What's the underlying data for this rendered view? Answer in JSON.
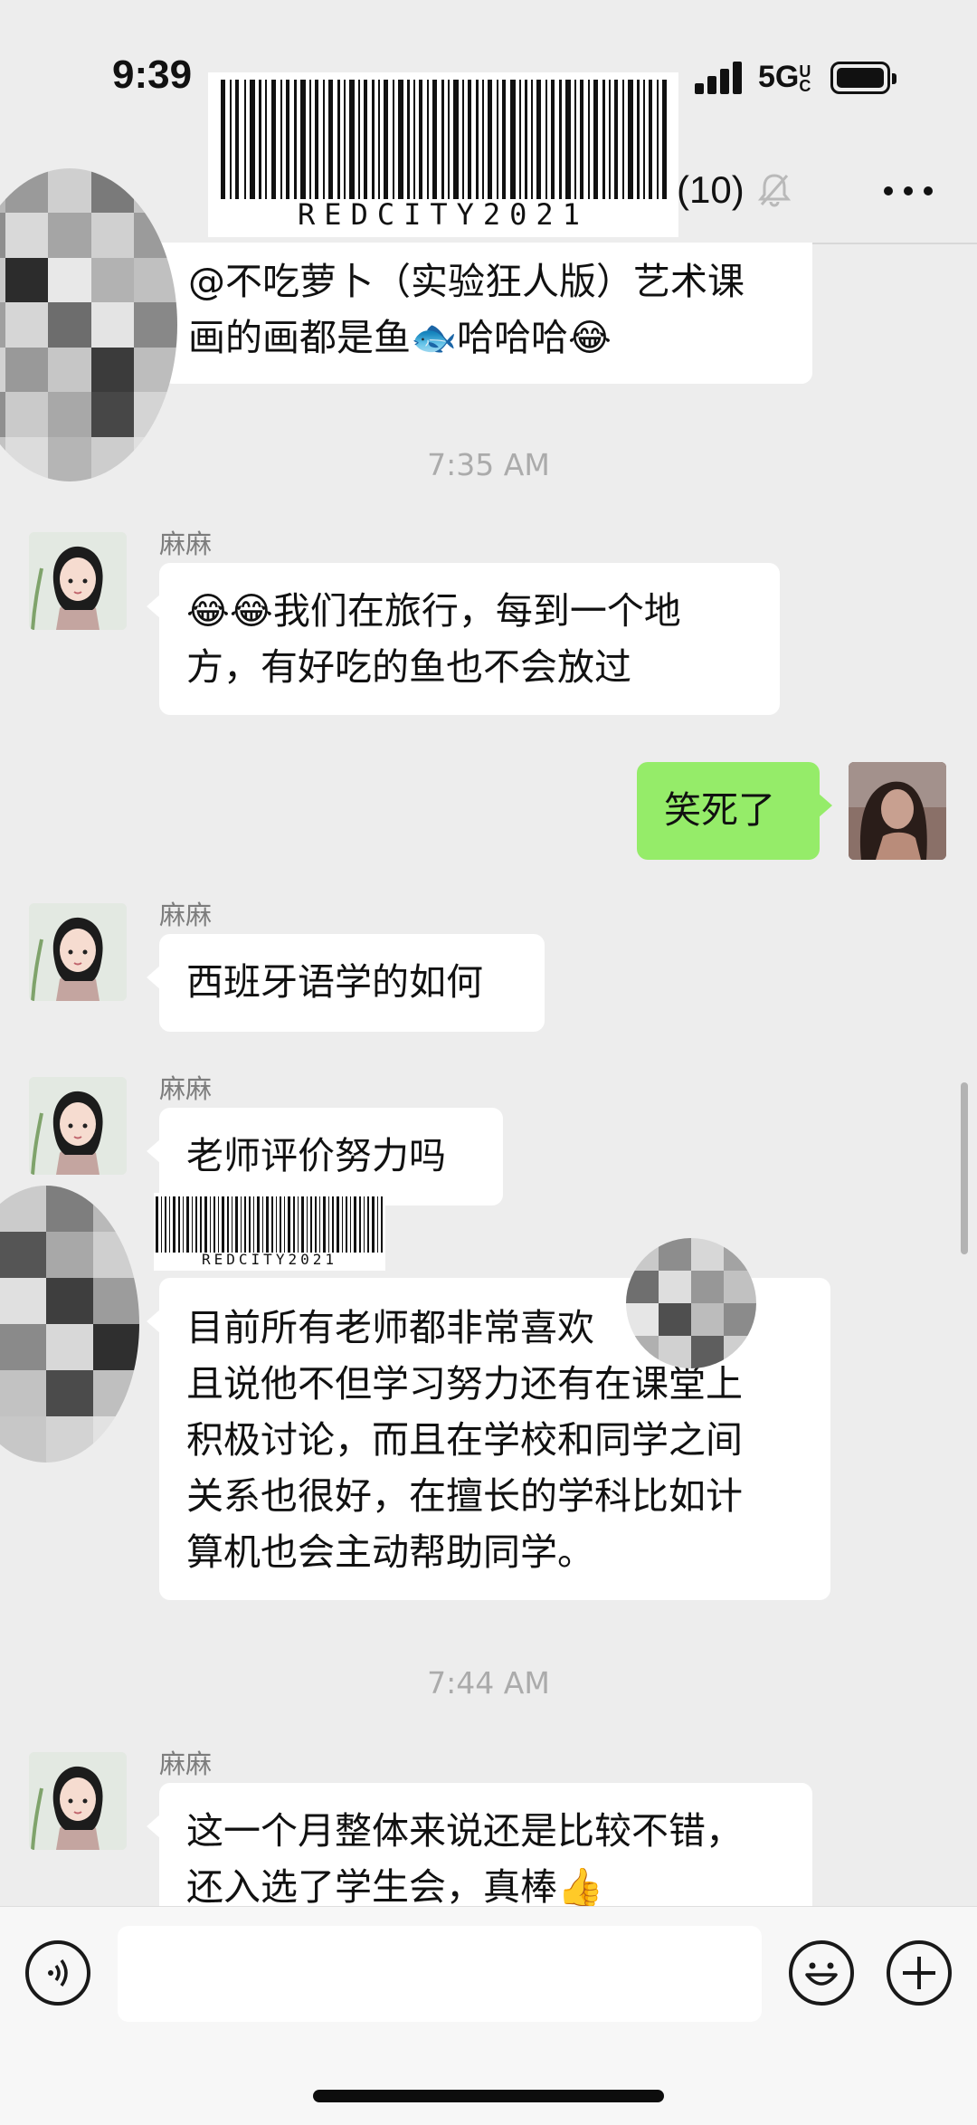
{
  "status_bar": {
    "time": "9:39",
    "network": "5G",
    "network_sub": "UC"
  },
  "header": {
    "member_count": "(10)",
    "mute_icon": "bell-slash-icon",
    "more_icon": "more-dots-icon"
  },
  "stickers": {
    "barcode_text": "REDCITY2021"
  },
  "messages": [
    {
      "type": "incoming-partial",
      "text": "@不吃萝卜（实验狂人版）艺术课\n画的画都是鱼🐟哈哈哈😂"
    },
    {
      "type": "timestamp",
      "text": "7:35 AM"
    },
    {
      "type": "incoming",
      "sender": "麻麻",
      "text": "😂😂我们在旅行，每到一个地\n方，有好吃的鱼也不会放过"
    },
    {
      "type": "outgoing",
      "text": "笑死了"
    },
    {
      "type": "incoming",
      "sender": "麻麻",
      "text": "西班牙语学的如何"
    },
    {
      "type": "incoming",
      "sender": "麻麻",
      "text": "老师评价努力吗"
    },
    {
      "type": "incoming",
      "text": "目前所有老师都非常喜欢　　　而\n且说他不但学习努力还有在课堂上\n积极讨论，而且在学校和同学之间\n关系也很好，在擅长的学科比如计\n算机也会主动帮助同学。"
    },
    {
      "type": "timestamp",
      "text": "7:44 AM"
    },
    {
      "type": "incoming",
      "sender": "麻麻",
      "text": "这一个月整体来说还是比较不错，\n还入选了学生会，真棒👍"
    }
  ],
  "input_bar": {
    "voice_icon": "voice-icon",
    "emoji_icon": "emoji-icon",
    "plus_icon": "plus-icon"
  },
  "colors": {
    "background": "#ededed",
    "outgoing_bubble": "#95ec69",
    "incoming_bubble": "#ffffff"
  }
}
